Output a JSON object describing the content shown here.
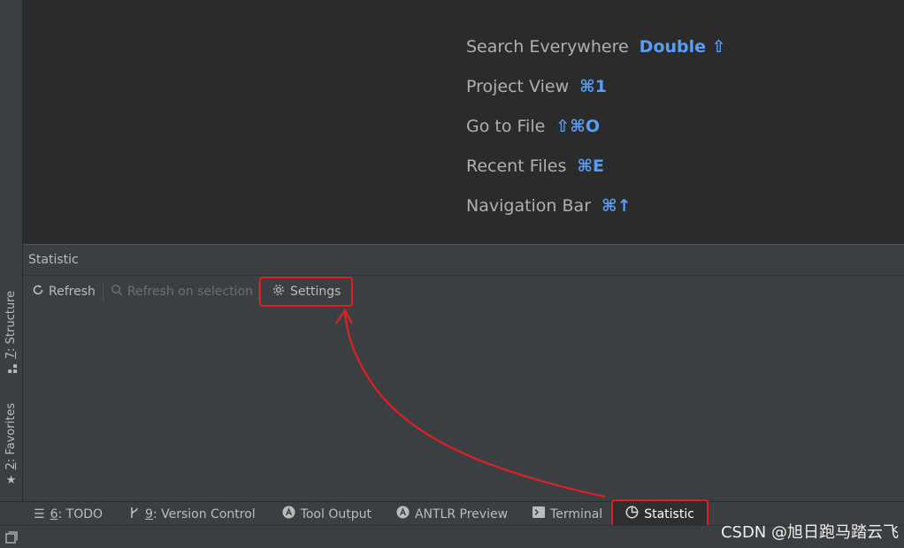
{
  "editor": {
    "hints": [
      {
        "label": "Search Everywhere",
        "key": "Double ⇧"
      },
      {
        "label": "Project View",
        "key": "⌘1"
      },
      {
        "label": "Go to File",
        "key": "⇧⌘O"
      },
      {
        "label": "Recent Files",
        "key": "⌘E"
      },
      {
        "label": "Navigation Bar",
        "key": "⌘↑"
      }
    ]
  },
  "left_strip": {
    "structure_num": "7",
    "structure_label": ": Structure",
    "favorites_num": "2",
    "favorites_label": ": Favorites"
  },
  "tool_window": {
    "title": "Statistic",
    "toolbar": {
      "refresh": "Refresh",
      "refresh_selection": "Refresh on selection",
      "settings": "Settings"
    }
  },
  "bottom_tabs": [
    {
      "num": "6",
      "label": ": TODO",
      "icon": "list-icon"
    },
    {
      "num": "9",
      "label": ": Version Control",
      "icon": "branch-icon"
    },
    {
      "num": "",
      "label": "Tool Output",
      "icon": "antlr-icon"
    },
    {
      "num": "",
      "label": "ANTLR Preview",
      "icon": "antlr-icon"
    },
    {
      "num": "",
      "label": "Terminal",
      "icon": "terminal-icon"
    },
    {
      "num": "",
      "label": "Statistic",
      "icon": "pie-chart-icon"
    }
  ],
  "watermark": "CSDN @旭日跑马踏云飞",
  "colors": {
    "highlight": "#e02020",
    "shortcut": "#589df6"
  }
}
